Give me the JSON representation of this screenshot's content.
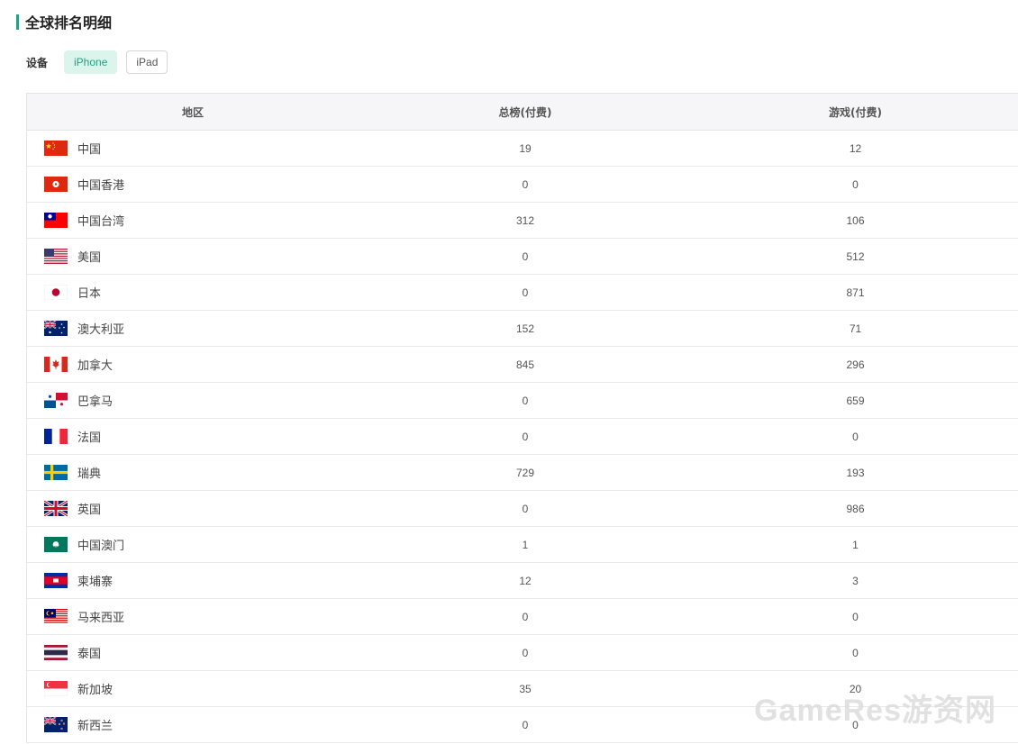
{
  "section_title": "全球排名明细",
  "device": {
    "label": "设备",
    "options": [
      {
        "label": "iPhone",
        "active": true
      },
      {
        "label": "iPad",
        "active": false
      }
    ]
  },
  "table": {
    "headers": [
      "地区",
      "总榜(付费)",
      "游戏(付费)"
    ],
    "rows": [
      {
        "flag": "cn-flag-icon",
        "region": "中国",
        "overall": "19",
        "games": "12"
      },
      {
        "flag": "hk-flag-icon",
        "region": "中国香港",
        "overall": "0",
        "games": "0"
      },
      {
        "flag": "tw-flag-icon",
        "region": "中国台湾",
        "overall": "312",
        "games": "106"
      },
      {
        "flag": "us-flag-icon",
        "region": "美国",
        "overall": "0",
        "games": "512"
      },
      {
        "flag": "jp-flag-icon",
        "region": "日本",
        "overall": "0",
        "games": "871"
      },
      {
        "flag": "au-flag-icon",
        "region": "澳大利亚",
        "overall": "152",
        "games": "71"
      },
      {
        "flag": "ca-flag-icon",
        "region": "加拿大",
        "overall": "845",
        "games": "296"
      },
      {
        "flag": "pa-flag-icon",
        "region": "巴拿马",
        "overall": "0",
        "games": "659"
      },
      {
        "flag": "fr-flag-icon",
        "region": "法国",
        "overall": "0",
        "games": "0"
      },
      {
        "flag": "se-flag-icon",
        "region": "瑞典",
        "overall": "729",
        "games": "193"
      },
      {
        "flag": "gb-flag-icon",
        "region": "英国",
        "overall": "0",
        "games": "986"
      },
      {
        "flag": "mo-flag-icon",
        "region": "中国澳门",
        "overall": "1",
        "games": "1"
      },
      {
        "flag": "kh-flag-icon",
        "region": "柬埔寨",
        "overall": "12",
        "games": "3"
      },
      {
        "flag": "my-flag-icon",
        "region": "马来西亚",
        "overall": "0",
        "games": "0"
      },
      {
        "flag": "th-flag-icon",
        "region": "泰国",
        "overall": "0",
        "games": "0"
      },
      {
        "flag": "sg-flag-icon",
        "region": "新加坡",
        "overall": "35",
        "games": "20"
      },
      {
        "flag": "nz-flag-icon",
        "region": "新西兰",
        "overall": "0",
        "games": "0"
      }
    ]
  },
  "watermark": "GameRes游资网",
  "colors": {
    "accent": "#1aa584",
    "chip_active_bg": "#dcf5ec",
    "header_bg": "#f6f6f8"
  }
}
